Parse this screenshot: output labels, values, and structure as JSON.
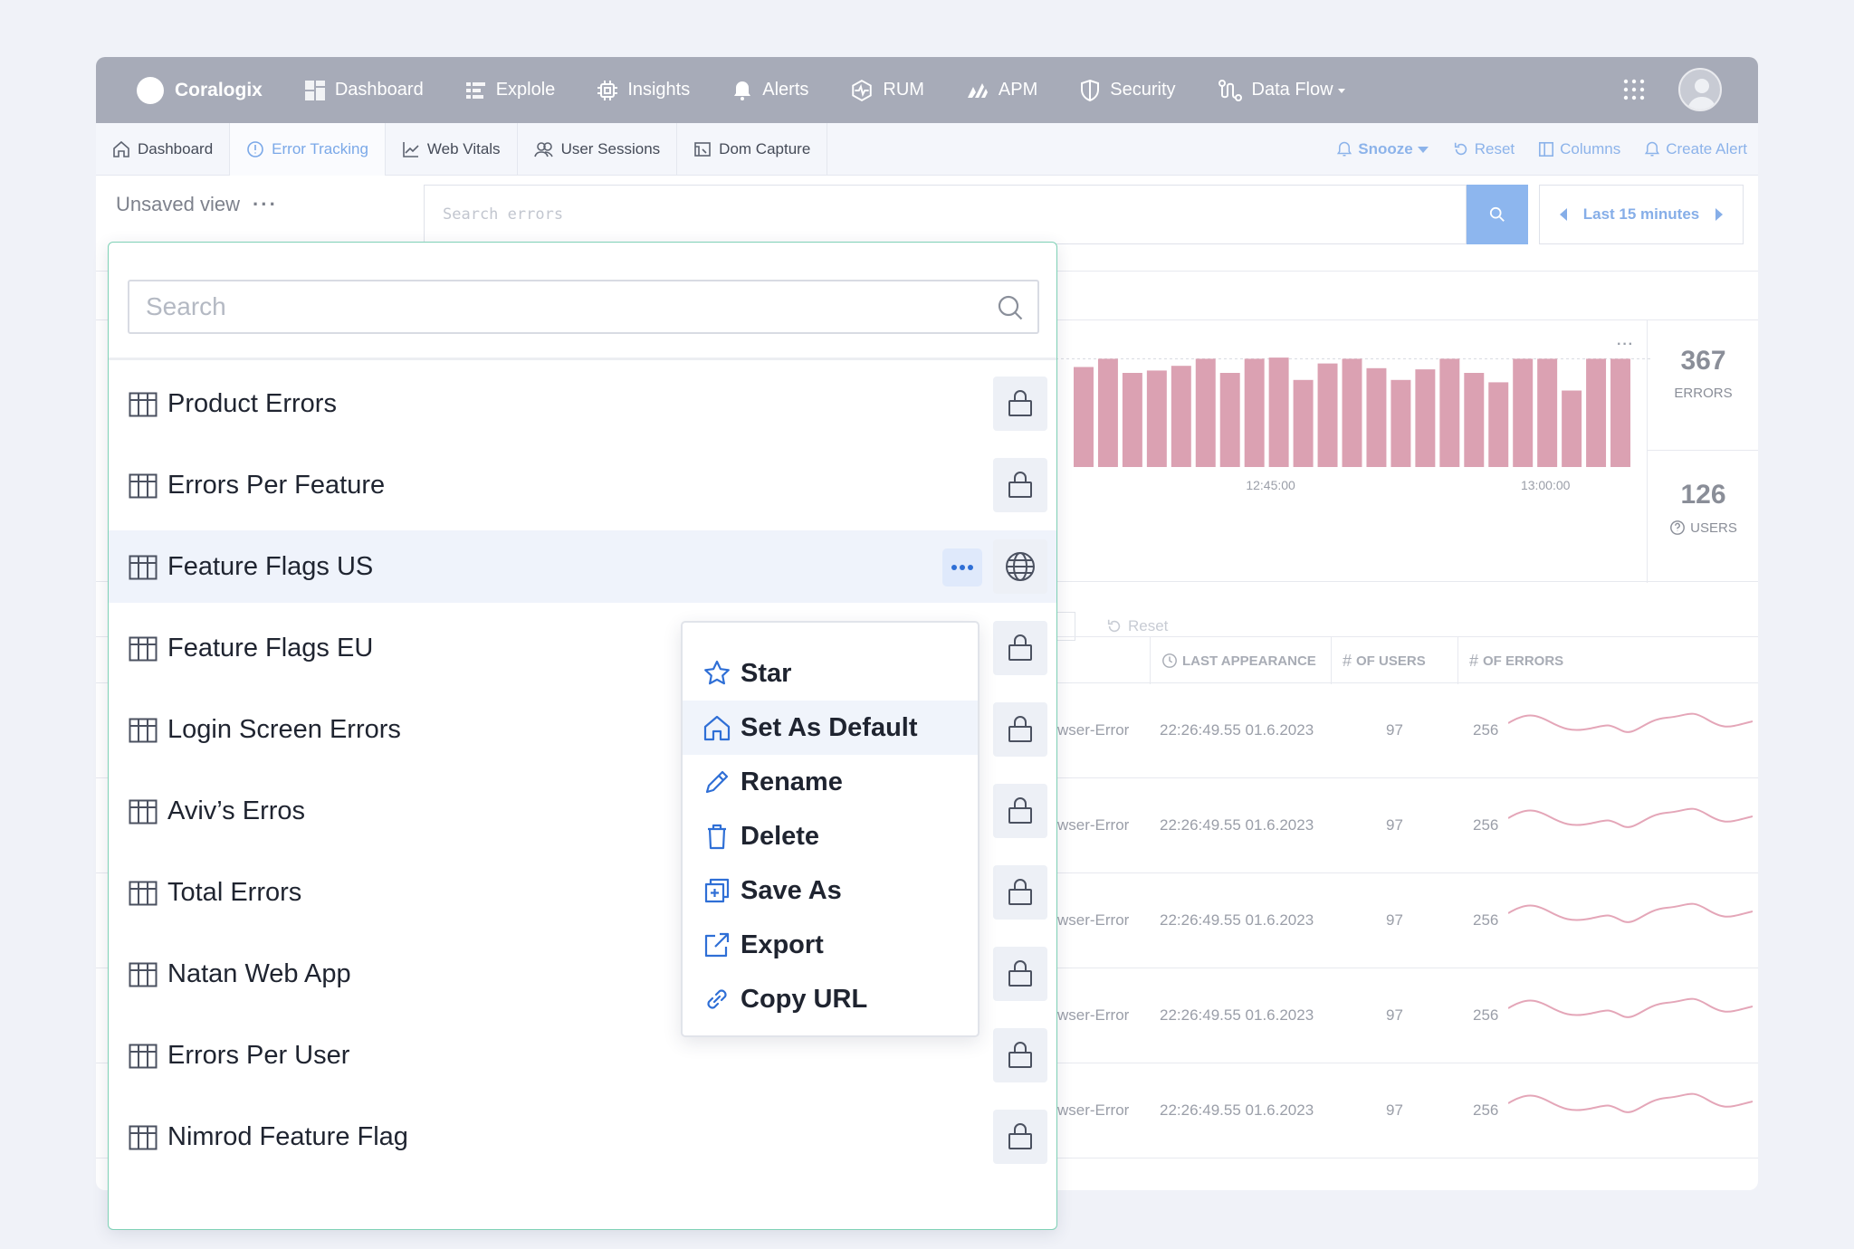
{
  "nav": {
    "brand": "Coralogix",
    "items": [
      {
        "label": "Dashboard",
        "icon": "dashboard-icon"
      },
      {
        "label": "Explole",
        "icon": "explore-icon"
      },
      {
        "label": "Insights",
        "icon": "insights-icon"
      },
      {
        "label": "Alerts",
        "icon": "bell-icon"
      },
      {
        "label": "RUM",
        "icon": "rum-icon"
      },
      {
        "label": "APM",
        "icon": "apm-icon"
      },
      {
        "label": "Security",
        "icon": "shield-icon"
      },
      {
        "label": "Data Flow",
        "icon": "data-flow-icon"
      }
    ]
  },
  "subnav": {
    "tabs": [
      {
        "label": "Dashboard",
        "icon": "home-icon"
      },
      {
        "label": "Error Tracking",
        "icon": "error-icon"
      },
      {
        "label": "Web Vitals",
        "icon": "line-chart-icon"
      },
      {
        "label": "User Sessions",
        "icon": "users-icon"
      },
      {
        "label": "Dom Capture",
        "icon": "capture-icon"
      }
    ],
    "active_tab": "Error Tracking",
    "actions": {
      "snooze": "Snooze",
      "reset": "Reset",
      "columns": "Columns",
      "create_alert": "Create Alert"
    }
  },
  "toolbar": {
    "view_title": "Unsaved view",
    "search_placeholder": "Search errors",
    "time_range": "Last 15 minutes"
  },
  "chart_data": {
    "type": "bar",
    "x_ticks": [
      "12:45:00",
      "13:00:00"
    ],
    "values": [
      85,
      92,
      80,
      82,
      86,
      92,
      80,
      92,
      93,
      74,
      88,
      92,
      84,
      74,
      83,
      92,
      80,
      72,
      92,
      92,
      65,
      92,
      92
    ],
    "color": "#dba1b2"
  },
  "kpis": {
    "errors_value": "367",
    "errors_label": "ERRORS",
    "users_value": "126",
    "users_label": "USERS"
  },
  "filters": {
    "reset": "Reset"
  },
  "table": {
    "columns": [
      "LAST APPEARANCE",
      "OF USERS",
      "OF ERRORS"
    ],
    "rows": [
      {
        "type": "wser-Error",
        "last_appearance": "22:26:49.55 01.6.2023",
        "users": "97",
        "errors": "256"
      },
      {
        "type": "wser-Error",
        "last_appearance": "22:26:49.55 01.6.2023",
        "users": "97",
        "errors": "256"
      },
      {
        "type": "wser-Error",
        "last_appearance": "22:26:49.55 01.6.2023",
        "users": "97",
        "errors": "256"
      },
      {
        "type": "wser-Error",
        "last_appearance": "22:26:49.55 01.6.2023",
        "users": "97",
        "errors": "256"
      },
      {
        "type": "wser-Error",
        "last_appearance": "22:26:49.55 01.6.2023",
        "users": "97",
        "errors": "256"
      }
    ]
  },
  "views_panel": {
    "search_placeholder": "Search",
    "views": [
      {
        "name": "Product Errors",
        "visibility": "private"
      },
      {
        "name": "Errors Per Feature",
        "visibility": "private"
      },
      {
        "name": "Feature Flags US",
        "visibility": "public",
        "highlighted": true
      },
      {
        "name": "Feature Flags EU",
        "visibility": "private"
      },
      {
        "name": "Login Screen Errors",
        "visibility": "private"
      },
      {
        "name": "Aviv’s Erros",
        "visibility": "private"
      },
      {
        "name": "Total Errors",
        "visibility": "private"
      },
      {
        "name": "Natan Web App",
        "visibility": "private"
      },
      {
        "name": "Errors Per User",
        "visibility": "private"
      },
      {
        "name": "Nimrod  Feature Flag",
        "visibility": "private"
      }
    ]
  },
  "context_menu": {
    "items": [
      {
        "label": "Star",
        "icon": "star-icon"
      },
      {
        "label": "Set As Default",
        "icon": "home-icon",
        "highlighted": true
      },
      {
        "label": "Rename",
        "icon": "pencil-icon"
      },
      {
        "label": "Delete",
        "icon": "trash-icon"
      },
      {
        "label": "Save As",
        "icon": "save-as-icon"
      },
      {
        "label": "Export",
        "icon": "export-icon"
      },
      {
        "label": "Copy URL",
        "icon": "link-icon"
      }
    ]
  }
}
